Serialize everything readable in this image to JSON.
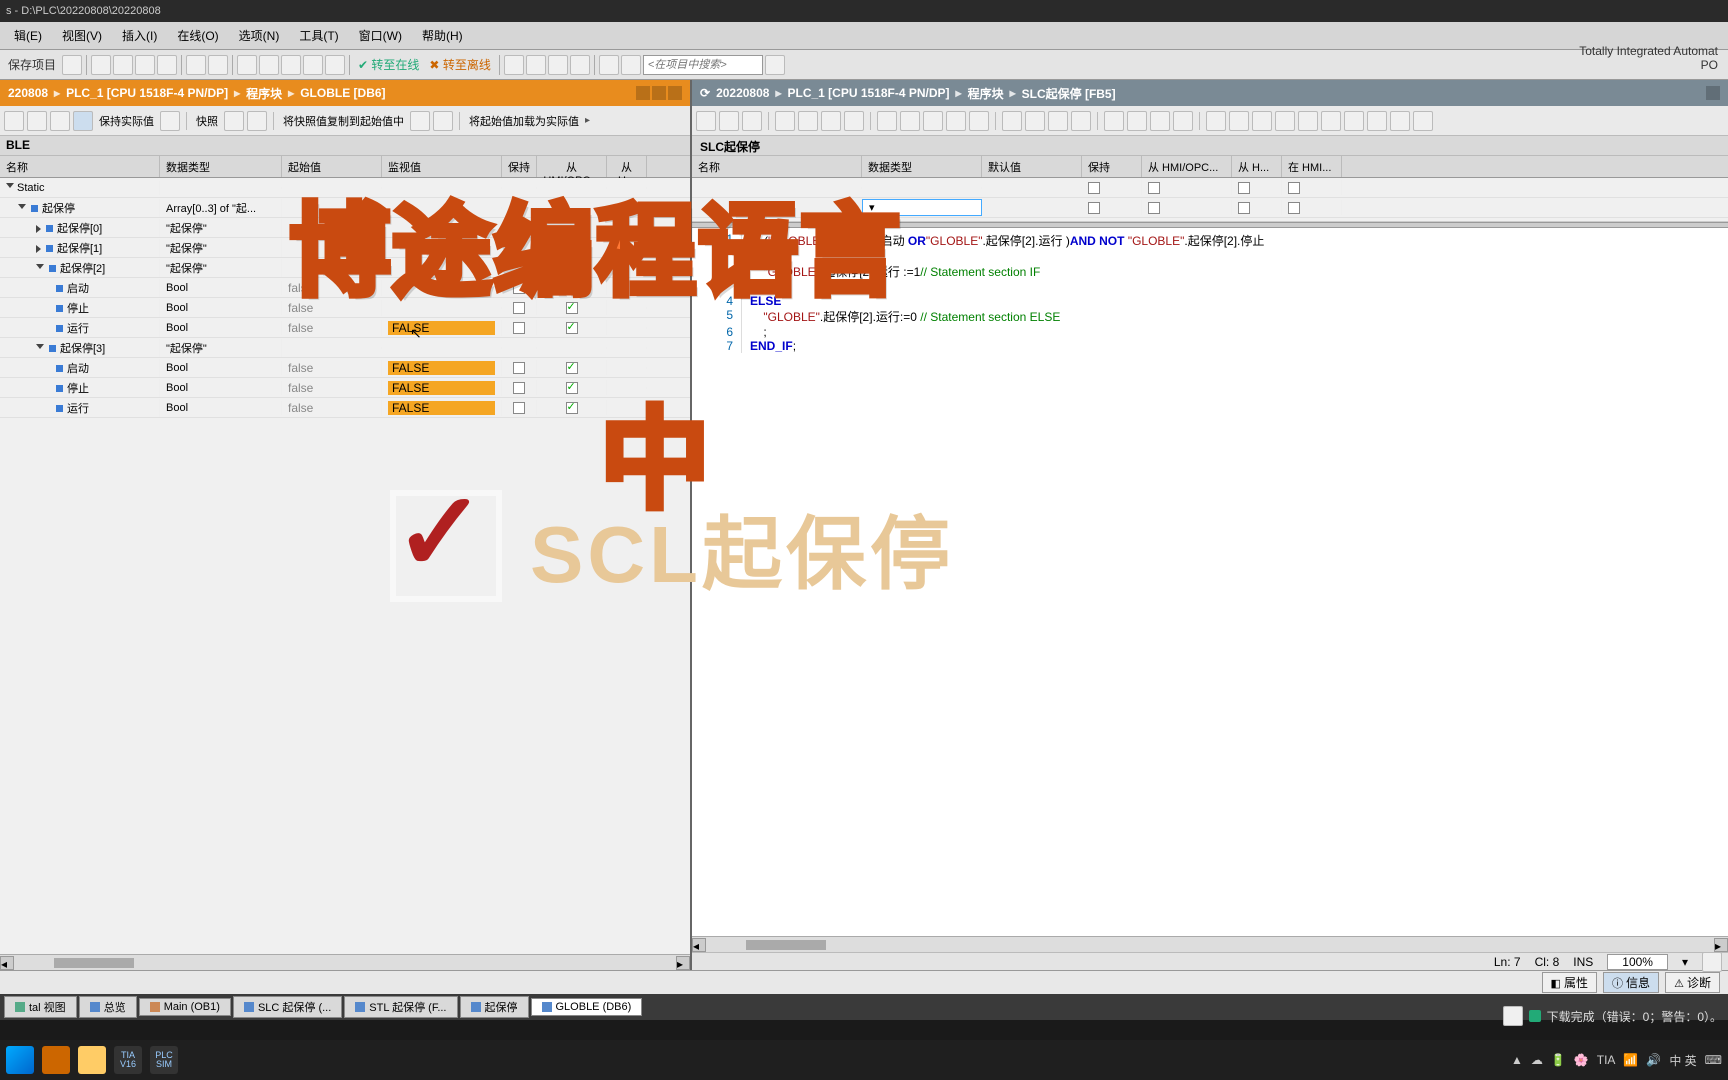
{
  "titlebar": "s - D:\\PLC\\20220808\\20220808",
  "menu": [
    "辑(E)",
    "视图(V)",
    "插入(I)",
    "在线(O)",
    "选项(N)",
    "工具(T)",
    "窗口(W)",
    "帮助(H)"
  ],
  "toolbar": {
    "save": "保存项目",
    "goOnline": "转至在线",
    "goOffline": "转至离线",
    "searchPlaceholder": "<在项目中搜索>"
  },
  "brand": "Totally Integrated Automat",
  "brand2": "PO",
  "leftCrumb": [
    "220808",
    "PLC_1 [CPU 1518F-4 PN/DP]",
    "程序块",
    "GLOBLE [DB6]"
  ],
  "rightCrumb": [
    "20220808",
    "PLC_1 [CPU 1518F-4 PN/DP]",
    "程序块",
    "SLC起保停 [FB5]"
  ],
  "leftSubToolbar": {
    "keepActual": "保持实际值",
    "snapshot": "快照",
    "copySnapshot": "将快照值复制到起始值中",
    "loadActual": "将起始值加载为实际值"
  },
  "leftSection": "BLE",
  "gridHead": [
    "名称",
    "数据类型",
    "起始值",
    "监视值",
    "保持",
    "从 HMI/OPC...",
    "从 H..."
  ],
  "rightGridHead": [
    "名称",
    "数据类型",
    "默认值",
    "保持",
    "从 HMI/OPC...",
    "从 H...",
    "在 HMI..."
  ],
  "rows": [
    {
      "lvl": 0,
      "tri": "open",
      "name": "Static",
      "type": "",
      "init": "",
      "mon": "",
      "hl": false,
      "chk": [
        null,
        null,
        null
      ]
    },
    {
      "lvl": 1,
      "tri": "open",
      "dot": true,
      "name": "起保停",
      "type": "Array[0..3] of \"起...",
      "init": "",
      "mon": "",
      "hl": false,
      "chk": [
        null,
        null,
        null
      ]
    },
    {
      "lvl": 2,
      "tri": "closed",
      "dot": true,
      "name": "起保停[0]",
      "type": "\"起保停\"",
      "init": "",
      "mon": "",
      "hl": false,
      "chk": [
        null,
        null,
        null
      ]
    },
    {
      "lvl": 2,
      "tri": "closed",
      "dot": true,
      "name": "起保停[1]",
      "type": "\"起保停\"",
      "init": "",
      "mon": "",
      "hl": false,
      "chk": [
        null,
        null,
        null
      ]
    },
    {
      "lvl": 2,
      "tri": "open",
      "dot": true,
      "name": "起保停[2]",
      "type": "\"起保停\"",
      "init": "",
      "mon": "",
      "hl": false,
      "chk": [
        null,
        null,
        null
      ]
    },
    {
      "lvl": 3,
      "dot": true,
      "name": "启动",
      "type": "Bool",
      "init": "false",
      "mon": "",
      "hl": false,
      "chk": [
        false,
        true,
        null
      ]
    },
    {
      "lvl": 3,
      "dot": true,
      "name": "停止",
      "type": "Bool",
      "init": "false",
      "mon": "",
      "hl": false,
      "chk": [
        false,
        true,
        null
      ]
    },
    {
      "lvl": 3,
      "dot": true,
      "name": "运行",
      "type": "Bool",
      "init": "false",
      "mon": "FALSE",
      "hl": true,
      "chk": [
        false,
        true,
        null
      ]
    },
    {
      "lvl": 2,
      "tri": "open",
      "dot": true,
      "name": "起保停[3]",
      "type": "\"起保停\"",
      "init": "",
      "mon": "",
      "hl": false,
      "chk": [
        null,
        null,
        null
      ]
    },
    {
      "lvl": 3,
      "dot": true,
      "name": "启动",
      "type": "Bool",
      "init": "false",
      "mon": "FALSE",
      "hl": true,
      "chk": [
        false,
        true,
        null
      ]
    },
    {
      "lvl": 3,
      "dot": true,
      "name": "停止",
      "type": "Bool",
      "init": "false",
      "mon": "FALSE",
      "hl": true,
      "chk": [
        false,
        true,
        null
      ]
    },
    {
      "lvl": 3,
      "dot": true,
      "name": "运行",
      "type": "Bool",
      "init": "false",
      "mon": "FALSE",
      "hl": true,
      "chk": [
        false,
        true,
        null
      ]
    }
  ],
  "rightTitle": "SLC起保停",
  "codeLines": [
    {
      "n": 1,
      "html": "<span class='kw'>IF</span> (<span class='str'>\"GLOBLE\"</span>.起保停[2].启动 <span class='kw'>OR</span><span class='str'>\"GLOBLE\"</span>.起保停[2].运行 )<span class='kw'>AND NOT</span> <span class='str'>\"GLOBLE\"</span>.起保停[2].停止 "
    },
    {
      "n": "",
      "html": " "
    },
    {
      "n": "",
      "html": "    <span class='str'>\"GLOBLE\"</span>.起保停[2].运行 :=1<span class='cmt'>// Statement section IF</span>"
    },
    {
      "n": "",
      "html": "    ;"
    },
    {
      "n": 4,
      "html": "<span class='kw'>ELSE</span>"
    },
    {
      "n": 5,
      "html": "    <span class='str'>\"GLOBLE\"</span>.起保停[2].运行:=0 <span class='cmt'>// Statement section ELSE</span>"
    },
    {
      "n": 6,
      "html": "    ;"
    },
    {
      "n": 7,
      "html": "<span class='kw'>END_IF</span>;"
    }
  ],
  "status": {
    "ln": "Ln: 7",
    "col": "Cl: 8",
    "mode": "INS",
    "zoom": "100%"
  },
  "propTabs": [
    "属性",
    "信息",
    "诊断"
  ],
  "bottomTabs": [
    {
      "label": "tal 视图",
      "cls": ""
    },
    {
      "label": "总览",
      "cls": "b"
    },
    {
      "label": "Main (OB1)",
      "cls": "o"
    },
    {
      "label": "SLC 起保停 (...",
      "cls": "b"
    },
    {
      "label": "STL 起保停 (F...",
      "cls": "b"
    },
    {
      "label": "起保停",
      "cls": "b"
    },
    {
      "label": "GLOBLE (DB6)",
      "cls": "b",
      "active": true
    }
  ],
  "downloadStatus": "下载完成（错误：0；警告：0）。",
  "tray": {
    "lang": "中 英",
    "time": ""
  },
  "overlay": {
    "title": "博途编程语言",
    "mid": "中",
    "scl": "SCL起保停"
  }
}
